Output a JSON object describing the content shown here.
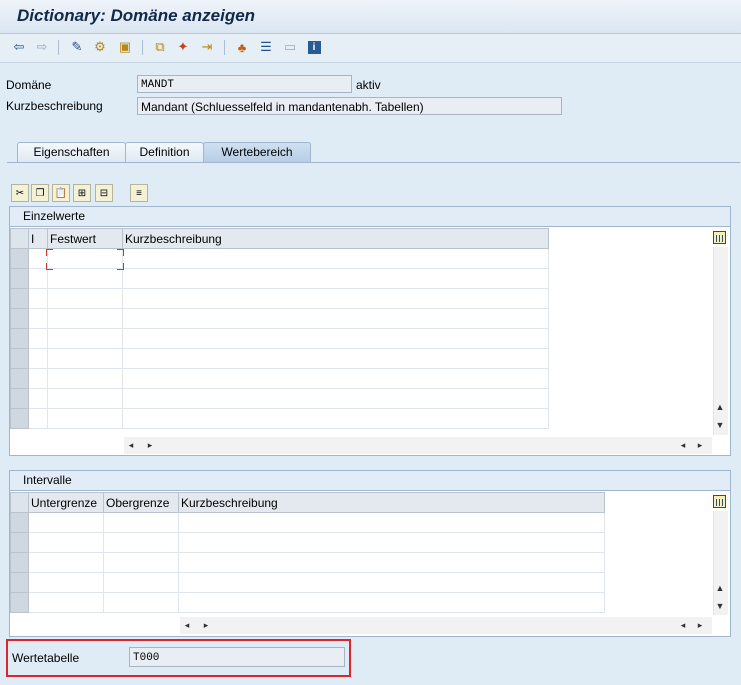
{
  "title": "Dictionary: Domäne anzeigen",
  "toolbar": {
    "icons": [
      "back-icon",
      "forward-icon",
      "other-object-icon",
      "active-inactive-icon",
      "display-object-list-icon",
      "where-used-icon",
      "enhancements-icon",
      "object-navigation-icon",
      "hierarchy-icon",
      "list-icon",
      "frame-icon",
      "info-icon"
    ]
  },
  "header": {
    "domain_label": "Domäne",
    "domain_value": "MANDT",
    "status": "aktiv",
    "short_label": "Kurzbeschreibung",
    "short_value": "Mandant (Schluesselfeld in mandantenabh. Tabellen)"
  },
  "tabs": [
    {
      "label": "Eigenschaften"
    },
    {
      "label": "Definition"
    },
    {
      "label": "Wertebereich"
    }
  ],
  "active_tab": "Wertebereich",
  "single_values": {
    "title": "Einzelwerte",
    "columns": [
      "I",
      "Festwert",
      "Kurzbeschreibung"
    ]
  },
  "intervals": {
    "title": "Intervalle",
    "columns": [
      "Untergrenze",
      "Obergrenze",
      "Kurzbeschreibung"
    ]
  },
  "value_table": {
    "label": "Wertetabelle",
    "value": "T000"
  }
}
